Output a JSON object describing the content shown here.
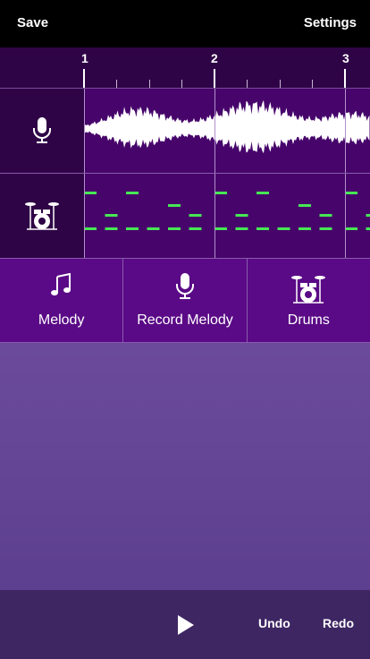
{
  "topbar": {
    "save_label": "Save",
    "settings_label": "Settings"
  },
  "timeline": {
    "bars": [
      "1",
      "2",
      "3"
    ]
  },
  "tracks": [
    {
      "name": "melody-recording",
      "icon": "microphone-icon"
    },
    {
      "name": "drums",
      "icon": "drum-kit-icon"
    }
  ],
  "instruments": [
    {
      "label": "Melody",
      "icon": "music-note-icon"
    },
    {
      "label": "Record Melody",
      "icon": "microphone-icon"
    },
    {
      "label": "Drums",
      "icon": "drum-kit-icon"
    }
  ],
  "bottombar": {
    "undo_label": "Undo",
    "redo_label": "Redo",
    "play_icon": "play-icon"
  },
  "colors": {
    "track_bg": "#47056b",
    "header_bg": "#2f0446",
    "instrument_bg": "#5a0a86",
    "drum_note": "#46e854",
    "workspace": "#6b4a9b",
    "bottombar": "#3e2663"
  }
}
